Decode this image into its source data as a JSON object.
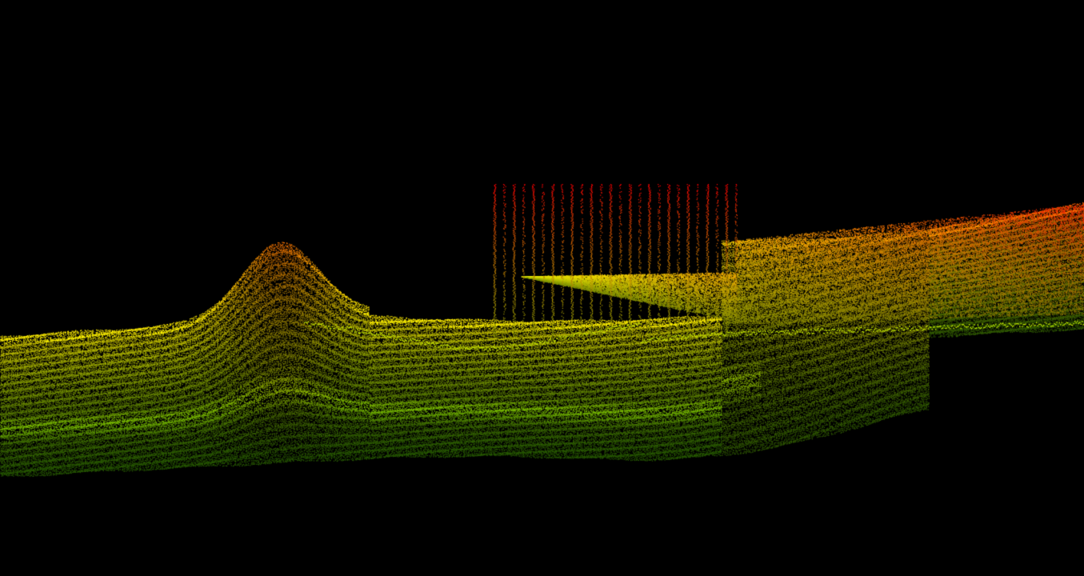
{
  "viewer": {
    "background": "#000000",
    "color_ramp": [
      "#00ff3c",
      "#7dff00",
      "#ffff00",
      "#ff8c00",
      "#ff0000"
    ],
    "color_mode": "elevation"
  },
  "scene": {
    "layers": [
      "terrain-point-cloud",
      "structure-point-cloud"
    ]
  }
}
